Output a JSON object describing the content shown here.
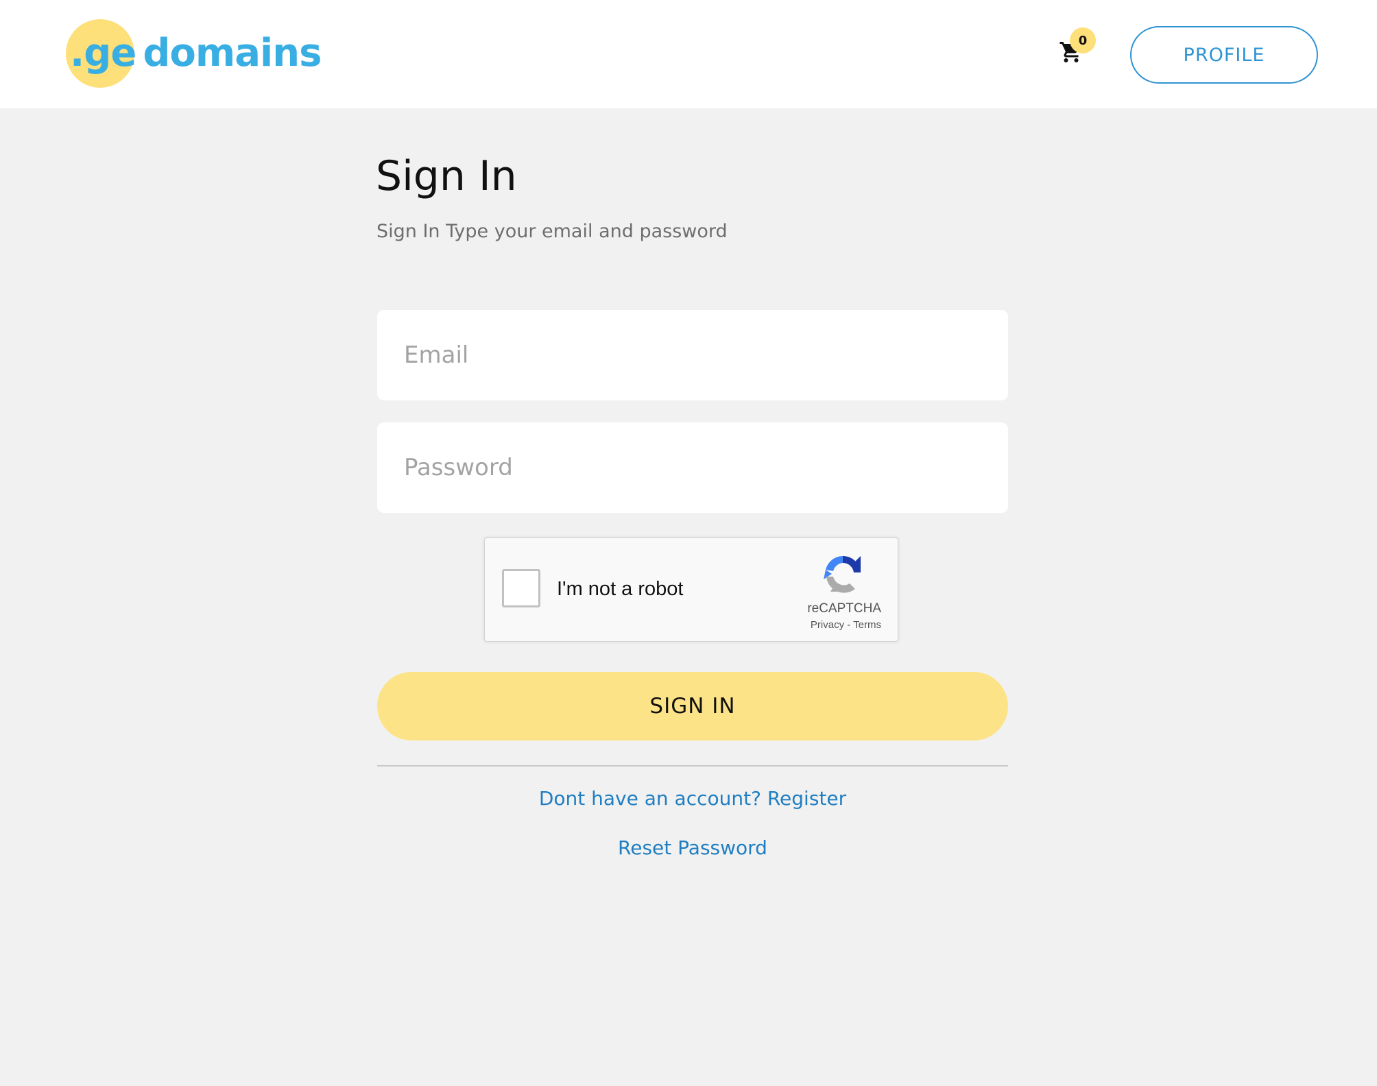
{
  "header": {
    "logo": {
      "prefix": ".ge",
      "text": "domains"
    },
    "cart": {
      "icon": "shopping-cart-icon",
      "count": "0"
    },
    "profile_label": "PROFILE"
  },
  "main": {
    "title": "Sign In",
    "subtitle": "Sign In Type your email and password",
    "email": {
      "placeholder": "Email",
      "value": ""
    },
    "password": {
      "placeholder": "Password",
      "value": ""
    },
    "recaptcha": {
      "label": "I'm not a robot",
      "brand": "reCAPTCHA",
      "privacy": "Privacy",
      "separator": " - ",
      "terms": "Terms",
      "icon": "recaptcha-logo-icon"
    },
    "signin_label": "SIGN IN",
    "register_link": "Dont have an account? Register",
    "reset_link": "Reset Password"
  },
  "colors": {
    "brand_yellow": "#fde07a",
    "brand_blue": "#39aee3",
    "link_blue": "#1f7ec2",
    "background": "#f1f1f1"
  }
}
